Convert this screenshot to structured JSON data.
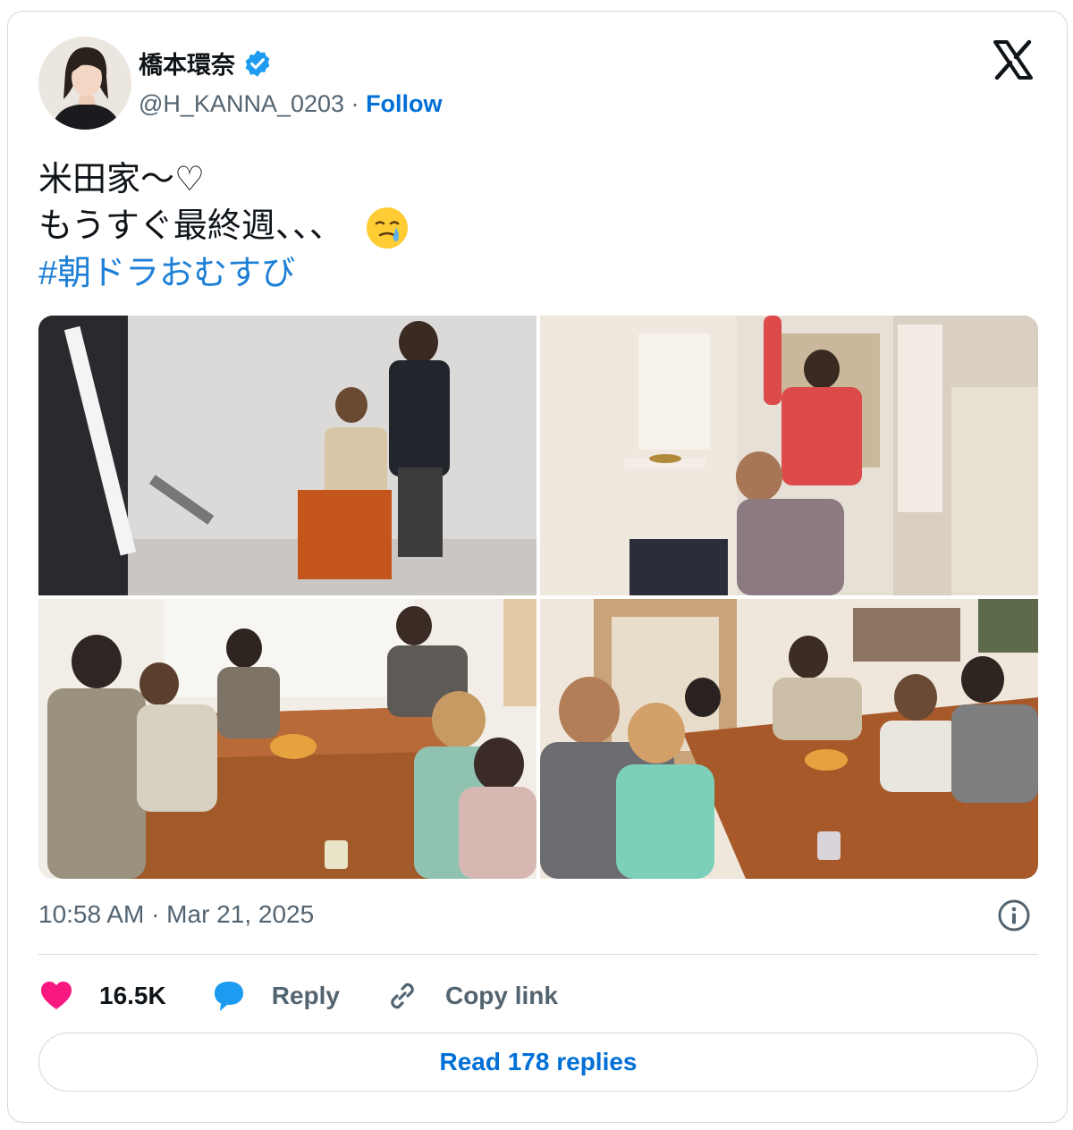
{
  "author": {
    "display_name": "橋本環奈",
    "verified": true,
    "handle": "@H_KANNA_0203",
    "separator": "·",
    "follow_label": "Follow"
  },
  "platform_icon": "x-logo-icon",
  "tweet": {
    "line1": "米田家〜♡",
    "line2": "もうすぐ最終週、、、",
    "line2_emoji": "face-holding-back-tears-icon",
    "hashtag": "#朝ドラおむすび"
  },
  "media": [
    {
      "name": "photo-studio-pose",
      "description_icon": "image"
    },
    {
      "name": "photo-hallway-pose",
      "description_icon": "image"
    },
    {
      "name": "photo-table-group-1",
      "description_icon": "image"
    },
    {
      "name": "photo-table-group-2",
      "description_icon": "image"
    }
  ],
  "timestamp": "10:58 AM · Mar 21, 2025",
  "actions": {
    "like_count": "16.5K",
    "reply_label": "Reply",
    "copy_link_label": "Copy link"
  },
  "read_replies_label": "Read 178 replies",
  "colors": {
    "link": "#006fd6",
    "hashtag": "#1d7fd6",
    "like": "#f91880",
    "reply_icon": "#1d9bf0",
    "verified": "#1d9bf0"
  }
}
